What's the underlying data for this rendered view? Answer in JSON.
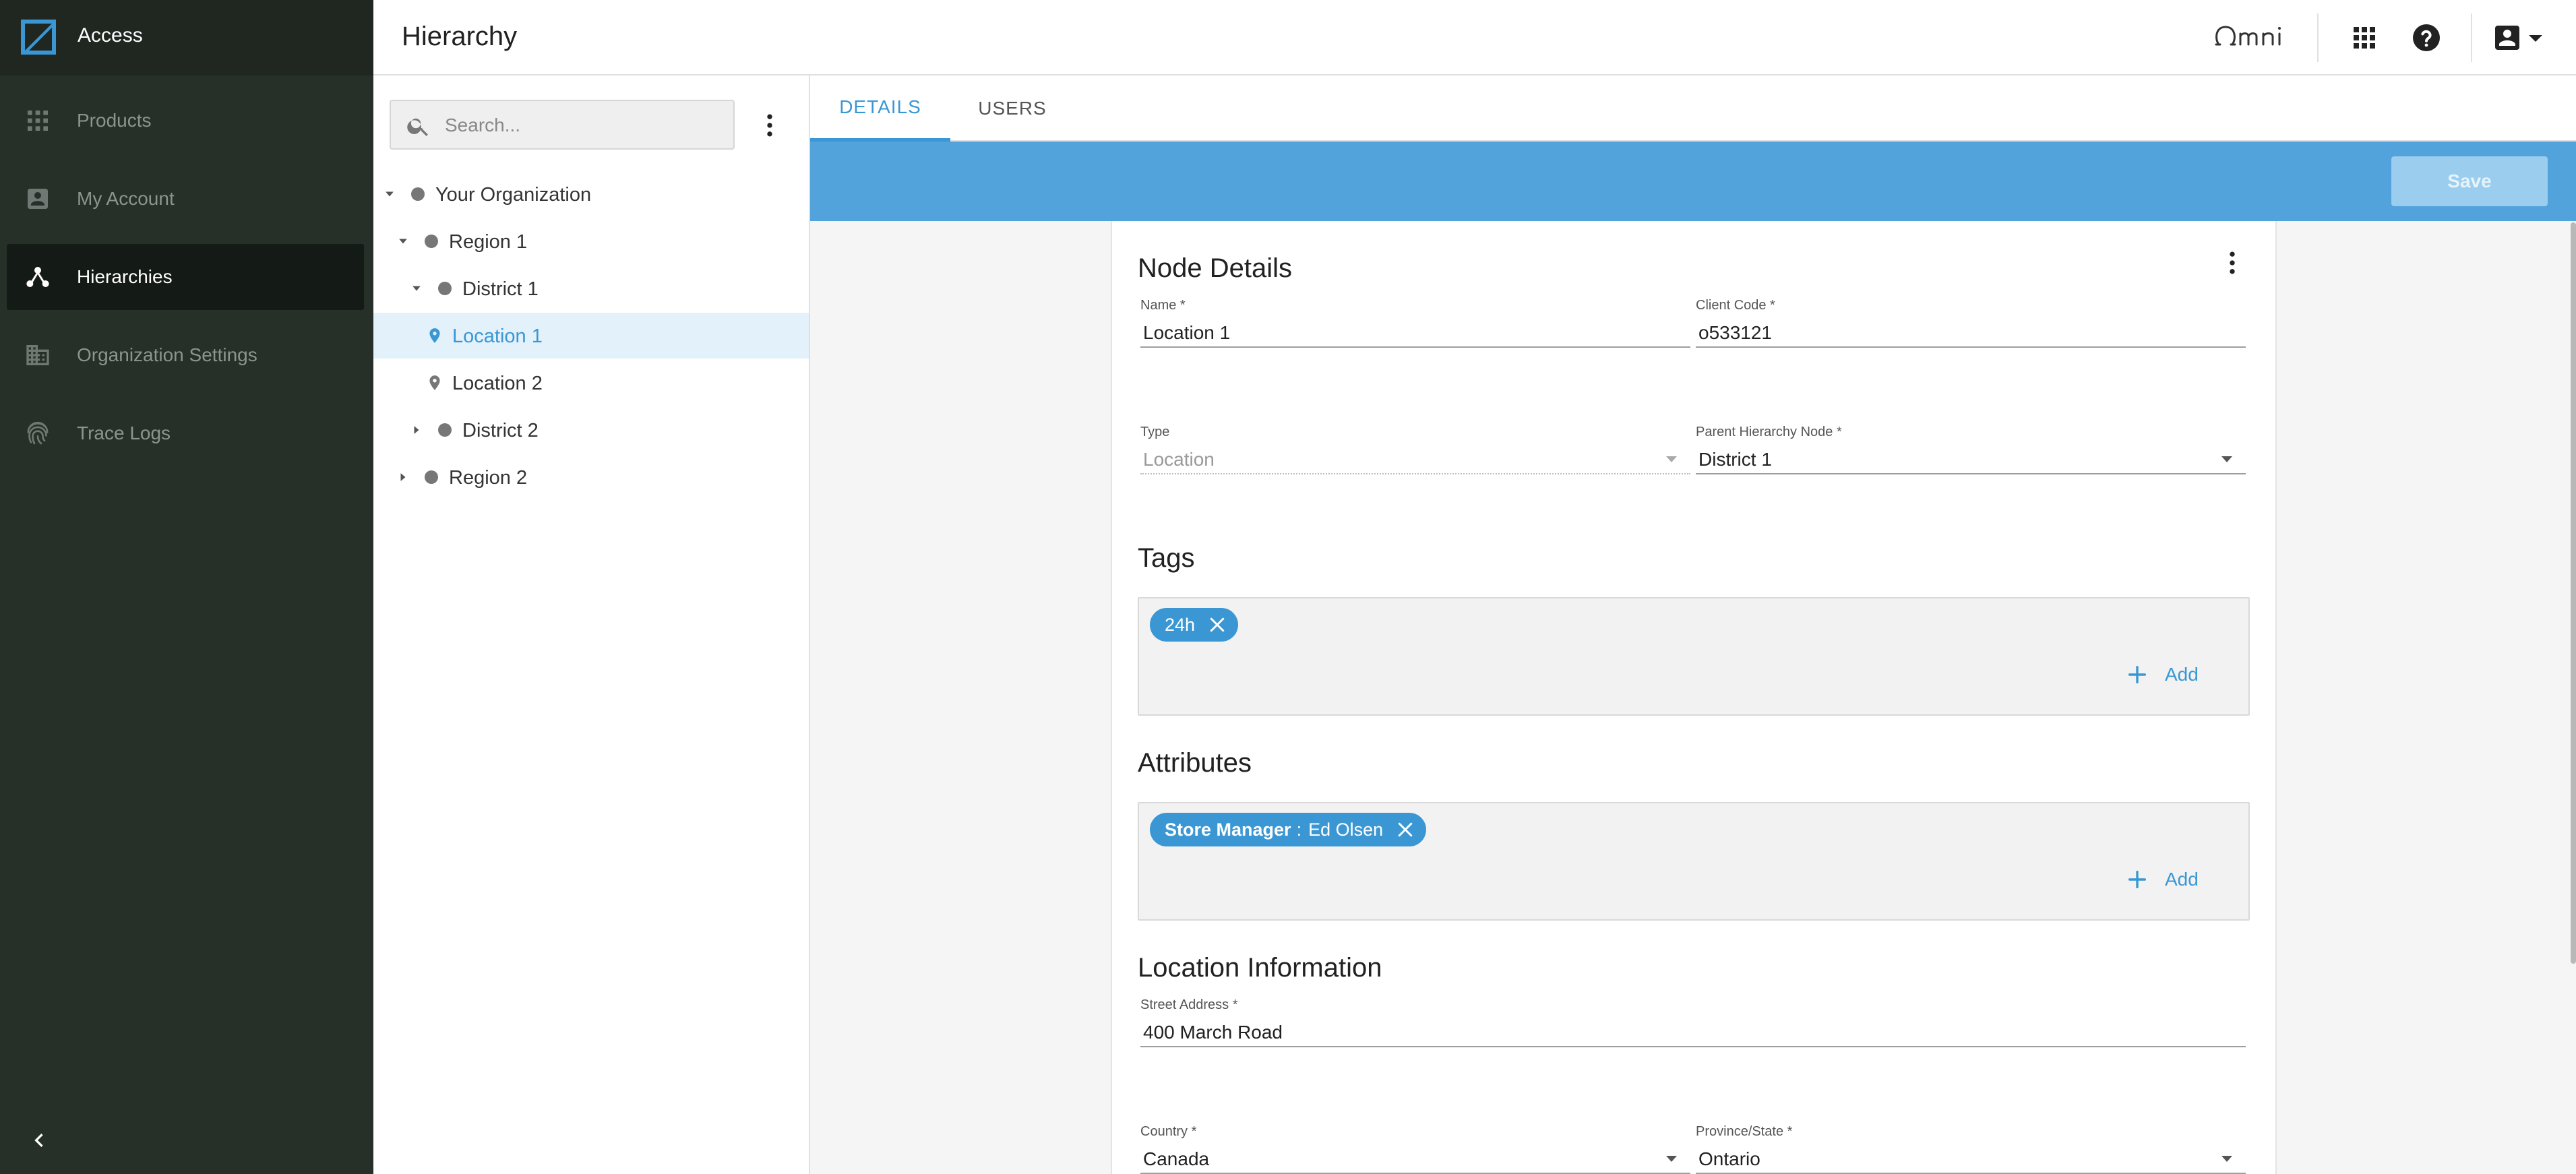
{
  "app": {
    "name": "Access",
    "page_title": "Hierarchy"
  },
  "sidebar": {
    "items": [
      {
        "label": "Products",
        "icon": "grid-icon",
        "active": false
      },
      {
        "label": "My Account",
        "icon": "account-box-icon",
        "active": false
      },
      {
        "label": "Hierarchies",
        "icon": "hierarchy-icon",
        "active": true
      },
      {
        "label": "Organization Settings",
        "icon": "building-icon",
        "active": false
      },
      {
        "label": "Trace Logs",
        "icon": "fingerprint-icon",
        "active": false
      }
    ],
    "collapse_icon": "chevron-left-icon"
  },
  "topbar": {
    "brand": "Omni",
    "icons": [
      "apps-grid-icon",
      "help-icon",
      "account-menu-icon"
    ]
  },
  "tree": {
    "search_placeholder": "Search...",
    "nodes": [
      {
        "label": "Your Organization",
        "type": "org",
        "expanded": true,
        "selected": false
      },
      {
        "label": "Region 1",
        "type": "region",
        "expanded": true,
        "selected": false
      },
      {
        "label": "District 1",
        "type": "district",
        "expanded": true,
        "selected": false
      },
      {
        "label": "Location 1",
        "type": "location",
        "selected": true
      },
      {
        "label": "Location 2",
        "type": "location",
        "selected": false
      },
      {
        "label": "District 2",
        "type": "district",
        "expanded": false,
        "selected": false
      },
      {
        "label": "Region 2",
        "type": "region",
        "expanded": false,
        "selected": false
      }
    ]
  },
  "tabs": [
    {
      "label": "DETAILS",
      "active": true
    },
    {
      "label": "USERS",
      "active": false
    }
  ],
  "toolbar": {
    "save_label": "Save"
  },
  "node_details": {
    "title": "Node Details",
    "name": {
      "label": "Name *",
      "value": "Location 1"
    },
    "client_code": {
      "label": "Client Code *",
      "value": "o533121"
    },
    "type": {
      "label": "Type",
      "value": "Location"
    },
    "parent": {
      "label": "Parent Hierarchy Node *",
      "value": "District 1"
    }
  },
  "tags": {
    "title": "Tags",
    "items": [
      "24h"
    ],
    "add_label": "Add"
  },
  "attributes": {
    "title": "Attributes",
    "items": [
      {
        "key": "Store Manager",
        "separator": ":",
        "value": "Ed Olsen"
      }
    ],
    "add_label": "Add"
  },
  "location_info": {
    "title": "Location Information",
    "street": {
      "label": "Street Address *",
      "value": "400 March Road"
    },
    "country": {
      "label": "Country *",
      "value": "Canada"
    },
    "province": {
      "label": "Province/State *",
      "value": "Ontario"
    }
  },
  "colors": {
    "accent": "#3a97d4",
    "banner": "#52a2dc",
    "sidebar": "#263028"
  }
}
